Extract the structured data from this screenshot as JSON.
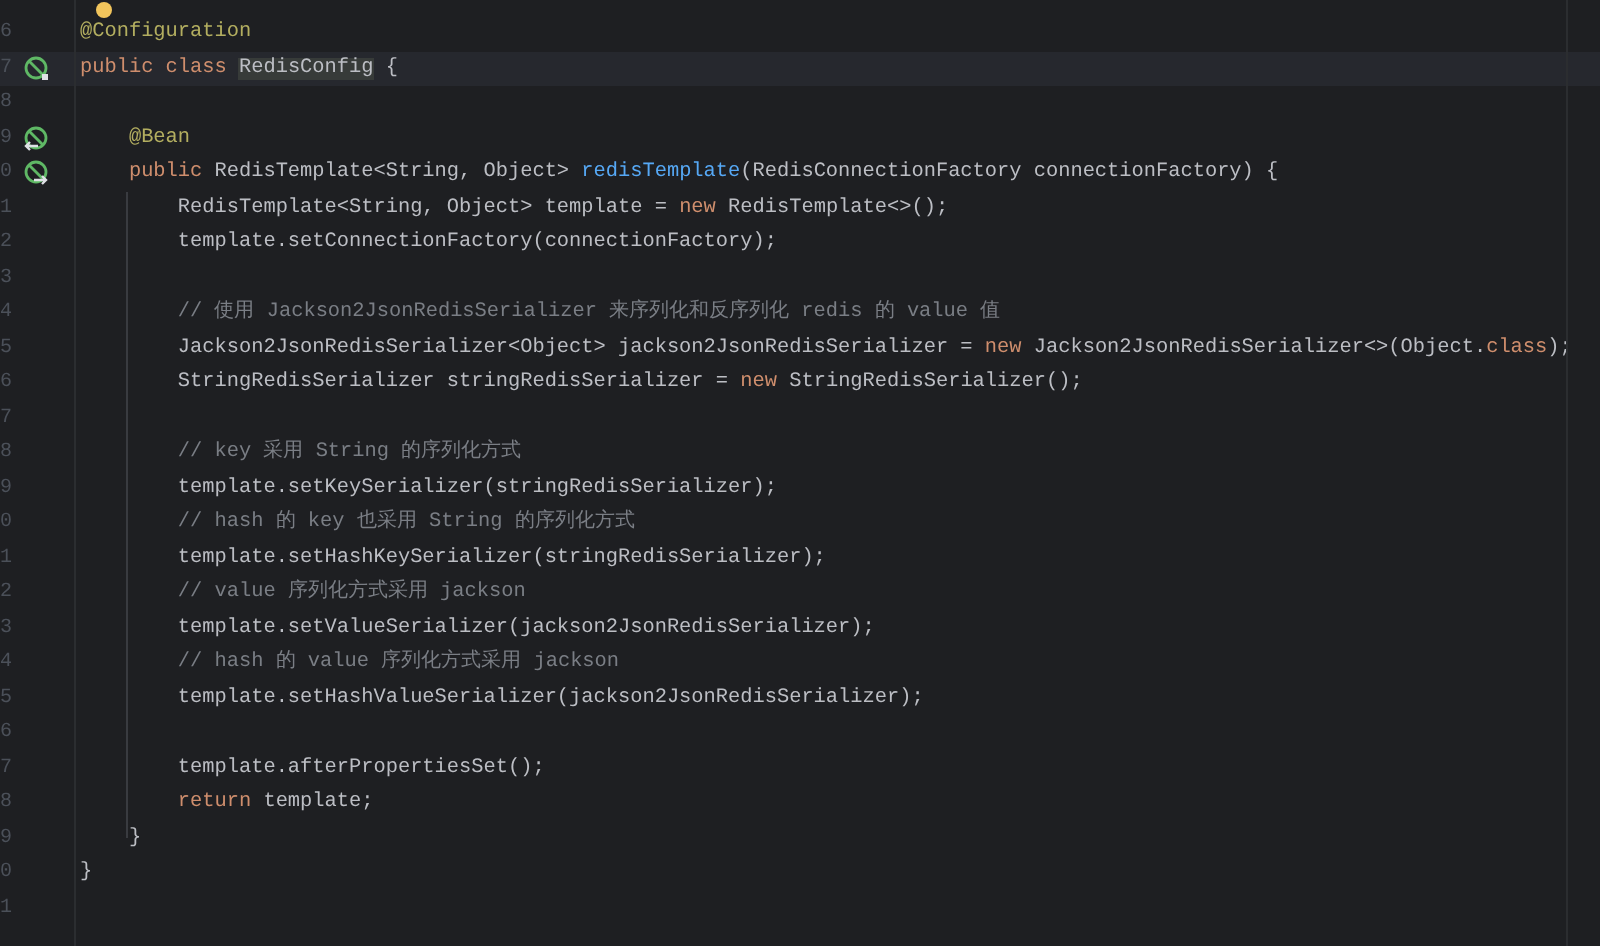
{
  "editor": {
    "lines": [
      {
        "number": "6",
        "current": false,
        "tokens": [
          {
            "kind": "annotation",
            "text": "@Configuration"
          }
        ]
      },
      {
        "number": "7",
        "current": true,
        "gutter_icon": {
          "kind": "marker"
        },
        "tokens": [
          {
            "kind": "keyword",
            "text": "public class "
          },
          {
            "kind": "highlight",
            "text": "RedisConfig"
          },
          {
            "kind": "plain",
            "text": " {"
          }
        ]
      },
      {
        "number": "8",
        "current": false
      },
      {
        "number": "9",
        "current": false,
        "gutter_icon": {
          "kind": "marker_left"
        },
        "tokens": [
          {
            "kind": "annotation",
            "text": "    @Bean"
          }
        ]
      },
      {
        "number": "0",
        "current": false,
        "gutter_icon": {
          "kind": "marker_right"
        },
        "tokens": [
          {
            "kind": "keyword",
            "text": "    public "
          },
          {
            "kind": "plain",
            "text": "RedisTemplate<String, Object> "
          },
          {
            "kind": "method",
            "text": "redisTemplate"
          },
          {
            "kind": "plain",
            "text": "(RedisConnectionFactory connectionFactory) {"
          }
        ]
      },
      {
        "number": "1",
        "current": false,
        "tokens": [
          {
            "kind": "plain",
            "text": "        RedisTemplate<String, Object> template = "
          },
          {
            "kind": "keyword",
            "text": "new "
          },
          {
            "kind": "plain",
            "text": "RedisTemplate<>();"
          }
        ]
      },
      {
        "number": "2",
        "current": false,
        "tokens": [
          {
            "kind": "plain",
            "text": "        template.setConnectionFactory(connectionFactory);"
          }
        ]
      },
      {
        "number": "3",
        "current": false
      },
      {
        "number": "4",
        "current": false,
        "tokens": [
          {
            "kind": "comment",
            "text": "        // 使用 Jackson2JsonRedisSerializer 来序列化和反序列化 redis 的 value 值"
          }
        ]
      },
      {
        "number": "5",
        "current": false,
        "tokens": [
          {
            "kind": "plain",
            "text": "        Jackson2JsonRedisSerializer<Object> jackson2JsonRedisSerializer = "
          },
          {
            "kind": "keyword",
            "text": "new "
          },
          {
            "kind": "plain",
            "text": "Jackson2JsonRedisSerializer<>(Object."
          },
          {
            "kind": "keyword",
            "text": "class"
          },
          {
            "kind": "plain",
            "text": ");"
          }
        ]
      },
      {
        "number": "6",
        "current": false,
        "tokens": [
          {
            "kind": "plain",
            "text": "        StringRedisSerializer stringRedisSerializer = "
          },
          {
            "kind": "keyword",
            "text": "new "
          },
          {
            "kind": "plain",
            "text": "StringRedisSerializer();"
          }
        ]
      },
      {
        "number": "7",
        "current": false
      },
      {
        "number": "8",
        "current": false,
        "tokens": [
          {
            "kind": "comment",
            "text": "        // key 采用 String 的序列化方式"
          }
        ]
      },
      {
        "number": "9",
        "current": false,
        "tokens": [
          {
            "kind": "plain",
            "text": "        template.setKeySerializer(stringRedisSerializer);"
          }
        ]
      },
      {
        "number": "0",
        "current": false,
        "tokens": [
          {
            "kind": "comment",
            "text": "        // hash 的 key 也采用 String 的序列化方式"
          }
        ]
      },
      {
        "number": "1",
        "current": false,
        "tokens": [
          {
            "kind": "plain",
            "text": "        template.setHashKeySerializer(stringRedisSerializer);"
          }
        ]
      },
      {
        "number": "2",
        "current": false,
        "tokens": [
          {
            "kind": "comment",
            "text": "        // value 序列化方式采用 jackson"
          }
        ]
      },
      {
        "number": "3",
        "current": false,
        "tokens": [
          {
            "kind": "plain",
            "text": "        template.setValueSerializer(jackson2JsonRedisSerializer);"
          }
        ]
      },
      {
        "number": "4",
        "current": false,
        "tokens": [
          {
            "kind": "comment",
            "text": "        // hash 的 value 序列化方式采用 jackson"
          }
        ]
      },
      {
        "number": "5",
        "current": false,
        "tokens": [
          {
            "kind": "plain",
            "text": "        template.setHashValueSerializer(jackson2JsonRedisSerializer);"
          }
        ]
      },
      {
        "number": "6",
        "current": false
      },
      {
        "number": "7",
        "current": false,
        "tokens": [
          {
            "kind": "plain",
            "text": "        template.afterPropertiesSet();"
          }
        ]
      },
      {
        "number": "8",
        "current": false,
        "tokens": [
          {
            "kind": "keyword",
            "text": "        return "
          },
          {
            "kind": "plain",
            "text": "template;"
          }
        ]
      },
      {
        "number": "9",
        "current": false,
        "tokens": [
          {
            "kind": "plain",
            "text": "    }"
          }
        ]
      },
      {
        "number": "0",
        "current": false,
        "tokens": [
          {
            "kind": "plain",
            "text": "}"
          }
        ]
      },
      {
        "number": "1",
        "current": false
      }
    ]
  }
}
